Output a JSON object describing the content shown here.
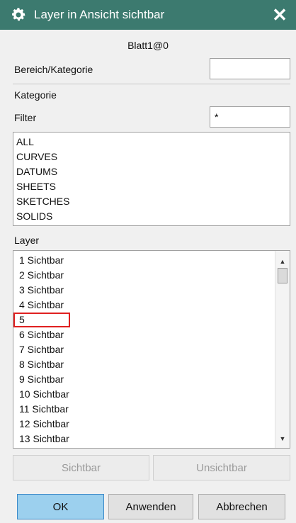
{
  "window": {
    "title": "Layer in Ansicht sichtbar",
    "view_name": "Blatt1@0",
    "icons": {
      "title": "gear-icon",
      "close": "close-icon"
    }
  },
  "range_category": {
    "label": "Bereich/Kategorie",
    "value": ""
  },
  "category": {
    "label": "Kategorie",
    "filter_label": "Filter",
    "filter_value": "*",
    "items": [
      "ALL",
      "CURVES",
      "DATUMS",
      "SHEETS",
      "SKETCHES",
      "SOLIDS"
    ]
  },
  "layers": {
    "label": "Layer",
    "items": [
      "1 Sichtbar",
      "2 Sichtbar",
      "3 Sichtbar",
      "4 Sichtbar",
      "5",
      "6 Sichtbar",
      "7 Sichtbar",
      "8 Sichtbar",
      "9 Sichtbar",
      "10 Sichtbar",
      "11 Sichtbar",
      "12 Sichtbar",
      "13 Sichtbar"
    ],
    "highlight_color": "#e02020"
  },
  "buttons": {
    "visible": "Sichtbar",
    "invisible": "Unsichtbar",
    "ok": "OK",
    "apply": "Anwenden",
    "cancel": "Abbrechen"
  },
  "colors": {
    "titlebar": "#3c7a6f",
    "ok_button": "#9cd0ee"
  }
}
